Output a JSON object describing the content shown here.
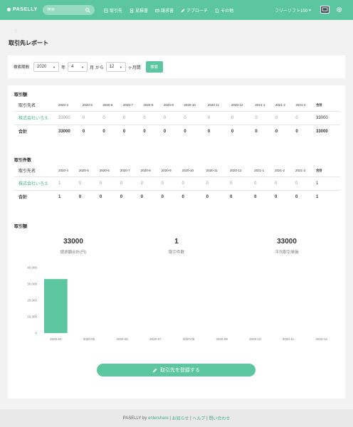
{
  "header": {
    "brand": "PASELLY",
    "search_placeholder": "検索",
    "nav": [
      "取引先",
      "見積書",
      "請求書",
      "アプローチ",
      "その他"
    ],
    "plan": "フリーソフト100",
    "plan_caret": "▾"
  },
  "breadcrumb": "‹ 一覧",
  "page_title": "取引先レポート",
  "filter": {
    "label": "検索期間",
    "year": "2020",
    "year_suffix": "年",
    "month": "4",
    "month_suffix": "月 から",
    "span": "12",
    "span_suffix": "ヶ月間",
    "search_button": "検索"
  },
  "amount_table": {
    "title": "取引額",
    "name_header": "取引先名",
    "months": [
      "2020-4",
      "2020-5",
      "2020-6",
      "2020-7",
      "2020-8",
      "2020-9",
      "2020-10",
      "2020-11",
      "2020-12",
      "2021-1",
      "2021-2",
      "2021-3"
    ],
    "sum_header": "合計",
    "rows": [
      {
        "name": "株式会社いろえ",
        "values": [
          "33000",
          "0",
          "0",
          "0",
          "0",
          "0",
          "0",
          "0",
          "0",
          "0",
          "0",
          "0"
        ],
        "sum": "33000"
      }
    ],
    "total": {
      "name": "合計",
      "values": [
        "33000",
        "0",
        "0",
        "0",
        "0",
        "0",
        "0",
        "0",
        "0",
        "0",
        "0",
        "0"
      ],
      "sum": "33000"
    }
  },
  "count_table": {
    "title": "取引件数",
    "name_header": "取引先名",
    "months": [
      "2020-4",
      "2020-5",
      "2020-6",
      "2020-7",
      "2020-8",
      "2020-9",
      "2020-10",
      "2020-11",
      "2020-12",
      "2021-1",
      "2021-2",
      "2021-3"
    ],
    "sum_header": "合計",
    "rows": [
      {
        "name": "株式会社いろえ",
        "values": [
          "1",
          "0",
          "0",
          "0",
          "0",
          "0",
          "0",
          "0",
          "0",
          "0",
          "0",
          "0"
        ],
        "sum": "1"
      }
    ],
    "total": {
      "name": "合計",
      "values": [
        "1",
        "0",
        "0",
        "0",
        "0",
        "0",
        "0",
        "0",
        "0",
        "0",
        "0",
        "0"
      ],
      "sum": "1"
    }
  },
  "chart_section": {
    "title": "取引額",
    "stats": [
      {
        "value": "33000",
        "caption": "請求額合計(円)"
      },
      {
        "value": "1",
        "caption": "取引件数"
      },
      {
        "value": "33000",
        "caption": "平均取引単価"
      }
    ]
  },
  "chart_data": {
    "type": "bar",
    "categories": [
      "2020-04",
      "2020-05",
      "2020-06",
      "2020-07",
      "2020-08",
      "2020-09",
      "2020-10",
      "2020-11",
      "2020-12"
    ],
    "values": [
      33000,
      0,
      0,
      0,
      0,
      0,
      0,
      0,
      0
    ],
    "ylim": [
      0,
      40000
    ],
    "yticks": [
      0,
      10000,
      20000,
      30000,
      40000
    ],
    "ytick_labels": [
      "0",
      "10,000",
      "20,000",
      "30,000",
      "40,000"
    ],
    "bar_color": "#5cc6a0",
    "grid": false
  },
  "register_button": "取引先を登録する",
  "footer": {
    "prefix": "PASELLY by",
    "company": "entershare",
    "sep": "|",
    "links": [
      "お知らせ",
      "ヘルプ",
      "問い合わせ"
    ]
  },
  "colors": {
    "accent": "#5cc6a0",
    "link": "#3fae8a"
  }
}
